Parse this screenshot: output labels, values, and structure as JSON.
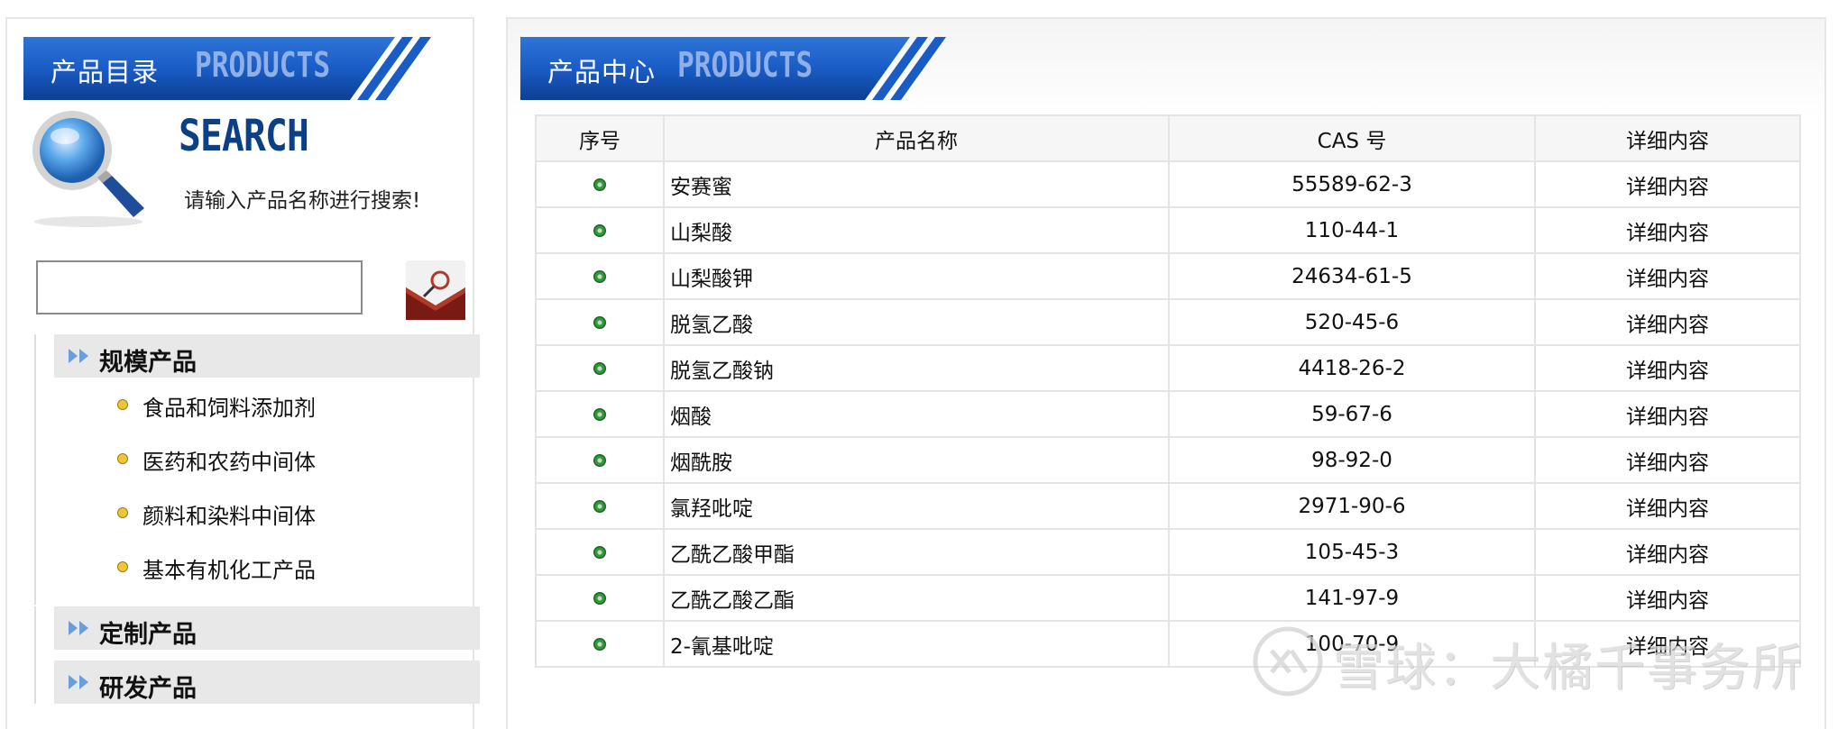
{
  "left": {
    "header_title": "产品目录",
    "header_en": "PRODUCTS",
    "search_title": "SEARCH",
    "search_hint": "请输入产品名称进行搜索!",
    "search_value": "",
    "sections": [
      {
        "label": "规模产品"
      },
      {
        "label": "定制产品"
      },
      {
        "label": "研发产品"
      }
    ],
    "subitems": [
      {
        "label": "食品和饲料添加剂"
      },
      {
        "label": "医药和农药中间体"
      },
      {
        "label": "颜料和染料中间体"
      },
      {
        "label": "基本有机化工产品"
      }
    ]
  },
  "center": {
    "header_title": "产品中心",
    "header_en": "PRODUCTS",
    "table": {
      "headers": [
        "序号",
        "产品名称",
        "CAS 号",
        "详细内容"
      ],
      "rows": [
        {
          "name": "安赛蜜",
          "cas": "55589-62-3",
          "detail": "详细内容"
        },
        {
          "name": "山梨酸",
          "cas": "110-44-1",
          "detail": "详细内容"
        },
        {
          "name": "山梨酸钾",
          "cas": "24634-61-5",
          "detail": "详细内容"
        },
        {
          "name": "脱氢乙酸",
          "cas": "520-45-6",
          "detail": "详细内容"
        },
        {
          "name": "脱氢乙酸钠",
          "cas": "4418-26-2",
          "detail": "详细内容"
        },
        {
          "name": "烟酸",
          "cas": "59-67-6",
          "detail": "详细内容"
        },
        {
          "name": "烟酰胺",
          "cas": "98-92-0",
          "detail": "详细内容"
        },
        {
          "name": "氯羟吡啶",
          "cas": "2971-90-6",
          "detail": "详细内容"
        },
        {
          "name": "乙酰乙酸甲酯",
          "cas": "105-45-3",
          "detail": "详细内容"
        },
        {
          "name": "乙酰乙酸乙酯",
          "cas": "141-97-9",
          "detail": "详细内容"
        },
        {
          "name": "2-氰基吡啶",
          "cas": "100-70-9",
          "detail": "详细内容"
        }
      ]
    }
  },
  "watermark": {
    "text": "雪球：大橘千事务所"
  },
  "colors": {
    "header_blue": "#1a5cc6",
    "header_dark": "#0d3f93",
    "bullet_green": "#2f9a3a",
    "nav_bg": "#e8e8e8",
    "dot_yellow": "#f0c537"
  },
  "icons": {
    "search_graphic": "magnifier-icon",
    "search_button": "search-button-icon",
    "section_arrow": "double-chevron-right-icon",
    "row_bullet": "green-bullet-icon",
    "sub_bullet": "yellow-dot-icon"
  }
}
